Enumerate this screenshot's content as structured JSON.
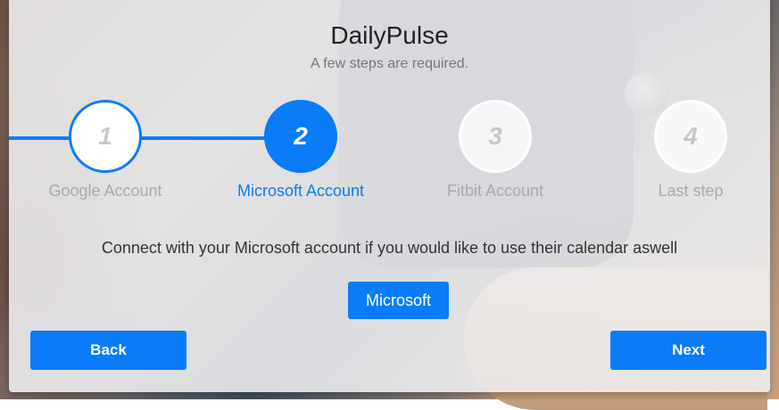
{
  "app": {
    "title": "DailyPulse",
    "subtitle": "A few steps are required."
  },
  "colors": {
    "accent": "#0a7cf7",
    "inactive_label": "#aaaaaa",
    "text": "#333333"
  },
  "steps": [
    {
      "number": "1",
      "label": "Google Account",
      "state": "done"
    },
    {
      "number": "2",
      "label": "Microsoft Account",
      "state": "active"
    },
    {
      "number": "3",
      "label": "Fitbit Account",
      "state": "pending"
    },
    {
      "number": "4",
      "label": "Last step",
      "state": "pending"
    }
  ],
  "content": {
    "message": "Connect with your Microsoft account if you would like to use their calendar aswell",
    "connect_button": "Microsoft"
  },
  "nav": {
    "back_label": "Back",
    "next_label": "Next"
  }
}
